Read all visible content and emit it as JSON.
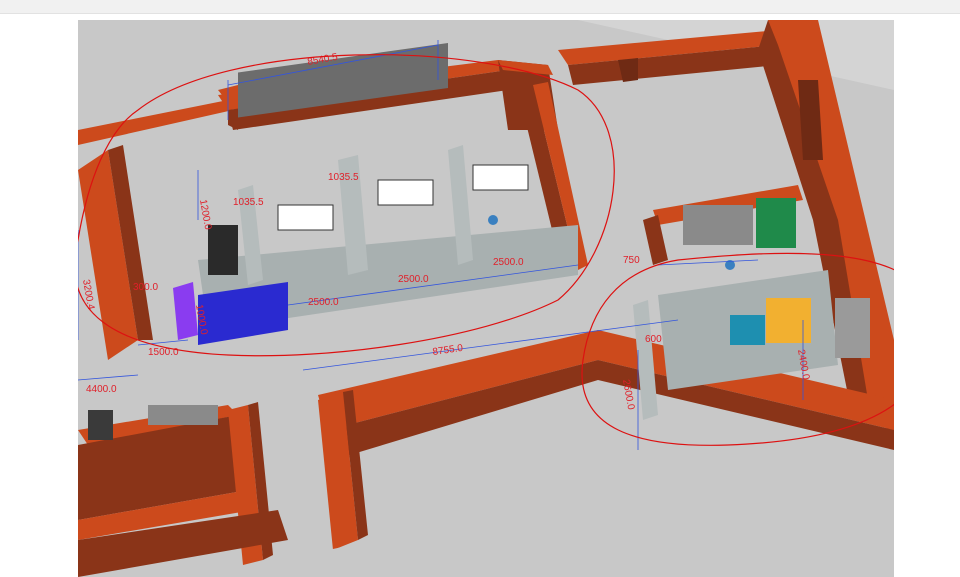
{
  "viewport": {
    "dimensions": [
      {
        "id": "dim-top",
        "label": "8540.5"
      },
      {
        "id": "dim-1200",
        "label": "1200.0"
      },
      {
        "id": "dim-1035-a",
        "label": "1035.5"
      },
      {
        "id": "dim-1035-b",
        "label": "1035.5"
      },
      {
        "id": "dim-3200",
        "label": "3200.4"
      },
      {
        "id": "dim-300",
        "label": "300.0"
      },
      {
        "id": "dim-1000",
        "label": "1000.0"
      },
      {
        "id": "dim-1500",
        "label": "1500.0"
      },
      {
        "id": "dim-2500-a",
        "label": "2500.0"
      },
      {
        "id": "dim-2500-b",
        "label": "2500.0"
      },
      {
        "id": "dim-2500-c",
        "label": "2500.0"
      },
      {
        "id": "dim-750",
        "label": "750"
      },
      {
        "id": "dim-8755",
        "label": "8755.0"
      },
      {
        "id": "dim-4400",
        "label": "4400.0"
      },
      {
        "id": "dim-2400",
        "label": "2400.0"
      },
      {
        "id": "dim-2600",
        "label": "2600.0"
      },
      {
        "id": "dim-600",
        "label": "600"
      }
    ],
    "colors": {
      "wall_top": "#cc4a1c",
      "wall_side": "#8a3418",
      "wall_dark": "#6f2a14",
      "floor": "#c8c8c8",
      "partition": "#a8b0b0",
      "dimension_line": "#3355dd",
      "dimension_text": "#e0202a",
      "markup": "#dd1111",
      "purple_cabinet": "#8a3cf0",
      "blue_counter": "#2a2ad0",
      "green_cabinet": "#1f8a4a",
      "yellow_cabinet": "#f2b030",
      "teal_box": "#1e8fb0"
    }
  }
}
